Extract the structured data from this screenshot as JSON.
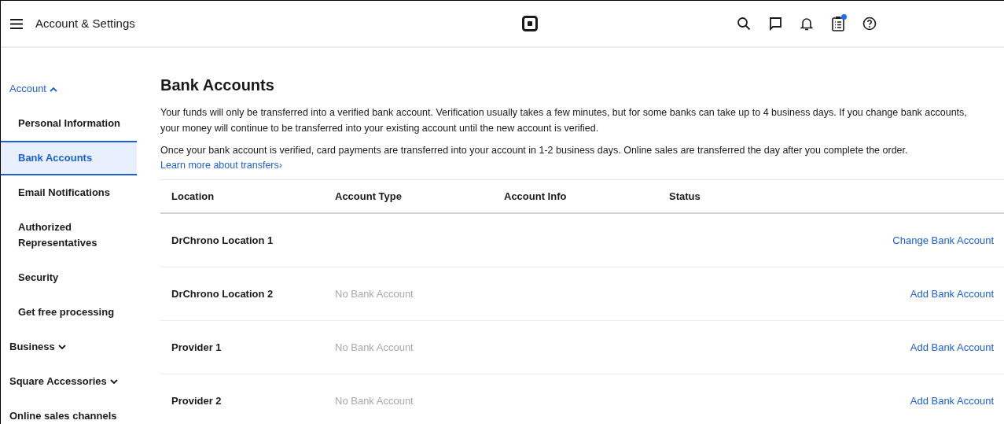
{
  "header": {
    "title": "Account & Settings",
    "notification_dot": true
  },
  "sidebar": {
    "groups": [
      {
        "label": "Account",
        "expanded": true,
        "items": [
          {
            "label": "Personal Information",
            "selected": false
          },
          {
            "label": "Bank Accounts",
            "selected": true
          },
          {
            "label": "Email Notifications",
            "selected": false
          },
          {
            "label": "Authorized Representatives",
            "selected": false
          },
          {
            "label": "Security",
            "selected": false
          },
          {
            "label": "Get free processing",
            "selected": false
          }
        ]
      },
      {
        "label": "Business",
        "expanded": false,
        "has_chevron": true
      },
      {
        "label": "Square Accessories",
        "expanded": false,
        "has_chevron": true
      },
      {
        "label": "Online sales channels",
        "expanded": false,
        "has_chevron": false
      }
    ]
  },
  "page": {
    "title": "Bank Accounts",
    "paragraphs": [
      "Your funds will only be transferred into a verified bank account. Verification usually takes a few minutes, but for some banks can take up to 4 business days. If you change bank accounts, your money will continue to be transferred into your existing account until the new account is verified.",
      "Once your bank account is verified, card payments are transferred into your account in 1-2 business days. Online sales are transferred the day after you complete the order."
    ],
    "link": "Learn more about transfers",
    "link_chevron": "›"
  },
  "table": {
    "columns": [
      "Location",
      "Account Type",
      "Account Info",
      "Status"
    ],
    "rows": [
      {
        "location": "DrChrono Location 1",
        "action": "Change Bank Account"
      },
      {
        "location": "DrChrono Location 2",
        "account_type": "No Bank Account",
        "action": "Add Bank Account"
      },
      {
        "location": "Provider 1",
        "account_type": "No Bank Account",
        "action": "Add Bank Account"
      },
      {
        "location": "Provider 2",
        "account_type": "No Bank Account",
        "action": "Add Bank Account"
      }
    ]
  }
}
